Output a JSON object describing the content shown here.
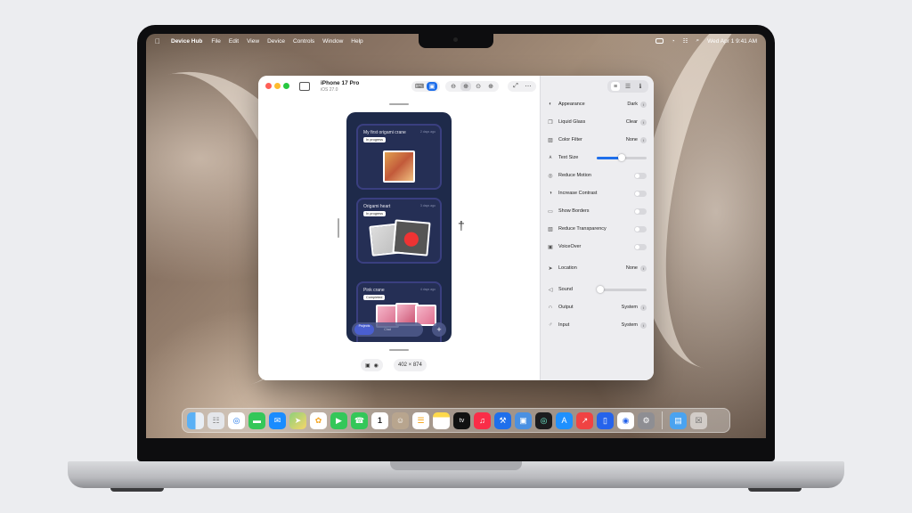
{
  "menubar": {
    "app_name": "Device Hub",
    "menus": [
      "File",
      "Edit",
      "View",
      "Device",
      "Controls",
      "Window",
      "Help"
    ],
    "clock": "Wed Apr 1  9:41 AM"
  },
  "window": {
    "device_name": "iPhone 17 Pro",
    "os_version": "iOS 27.0",
    "dimensions": "402 × 874"
  },
  "app_preview": {
    "cards": [
      {
        "title": "My first origami crane",
        "date": "2 days ago",
        "status": "In progress"
      },
      {
        "title": "Origami heart",
        "date": "3 days ago",
        "status": "In progress"
      },
      {
        "title": "Pink crane",
        "date": "4 days ago",
        "status": "Completed"
      }
    ],
    "tabs": [
      "Projects",
      "Chat"
    ],
    "add_label": "+"
  },
  "settings": {
    "appearance": {
      "label": "Appearance",
      "value": "Dark"
    },
    "liquid_glass": {
      "label": "Liquid Glass",
      "value": "Clear"
    },
    "color_filter": {
      "label": "Color Filter",
      "value": "None"
    },
    "text_size": {
      "label": "Text Size",
      "level": 0.5
    },
    "reduce_motion": {
      "label": "Reduce Motion",
      "on": false
    },
    "increase_contrast": {
      "label": "Increase Contrast",
      "on": false
    },
    "show_borders": {
      "label": "Show Borders",
      "on": false
    },
    "reduce_transparency": {
      "label": "Reduce Transparency",
      "on": false
    },
    "voiceover": {
      "label": "VoiceOver",
      "on": false
    },
    "location": {
      "label": "Location",
      "value": "None"
    },
    "sound": {
      "label": "Sound",
      "level": 0.0
    },
    "output": {
      "label": "Output",
      "value": "System"
    },
    "input": {
      "label": "Input",
      "value": "System"
    }
  },
  "colors": {
    "accent": "#1f6feb",
    "phone_bg": "#1e2a4a",
    "traffic_red": "#ff5f57",
    "traffic_yellow": "#febc2e",
    "traffic_green": "#28c840"
  },
  "dock": {
    "apps": [
      "finder-icon",
      "launchpad-icon",
      "safari-icon",
      "messages-icon",
      "mail-icon",
      "maps-icon",
      "photos-icon",
      "facetime-icon",
      "phone-icon",
      "calendar-icon",
      "contacts-icon",
      "reminders-icon",
      "notes-icon",
      "tv-icon",
      "music-icon",
      "xcode-instruments-icon",
      "simulator-icon",
      "terminal-icon",
      "app-store-icon",
      "rocketsim-icon",
      "reality-composer-icon",
      "accessibility-inspector-icon",
      "system-settings-icon"
    ],
    "calendar_day": "1",
    "tv_label": "tv"
  }
}
